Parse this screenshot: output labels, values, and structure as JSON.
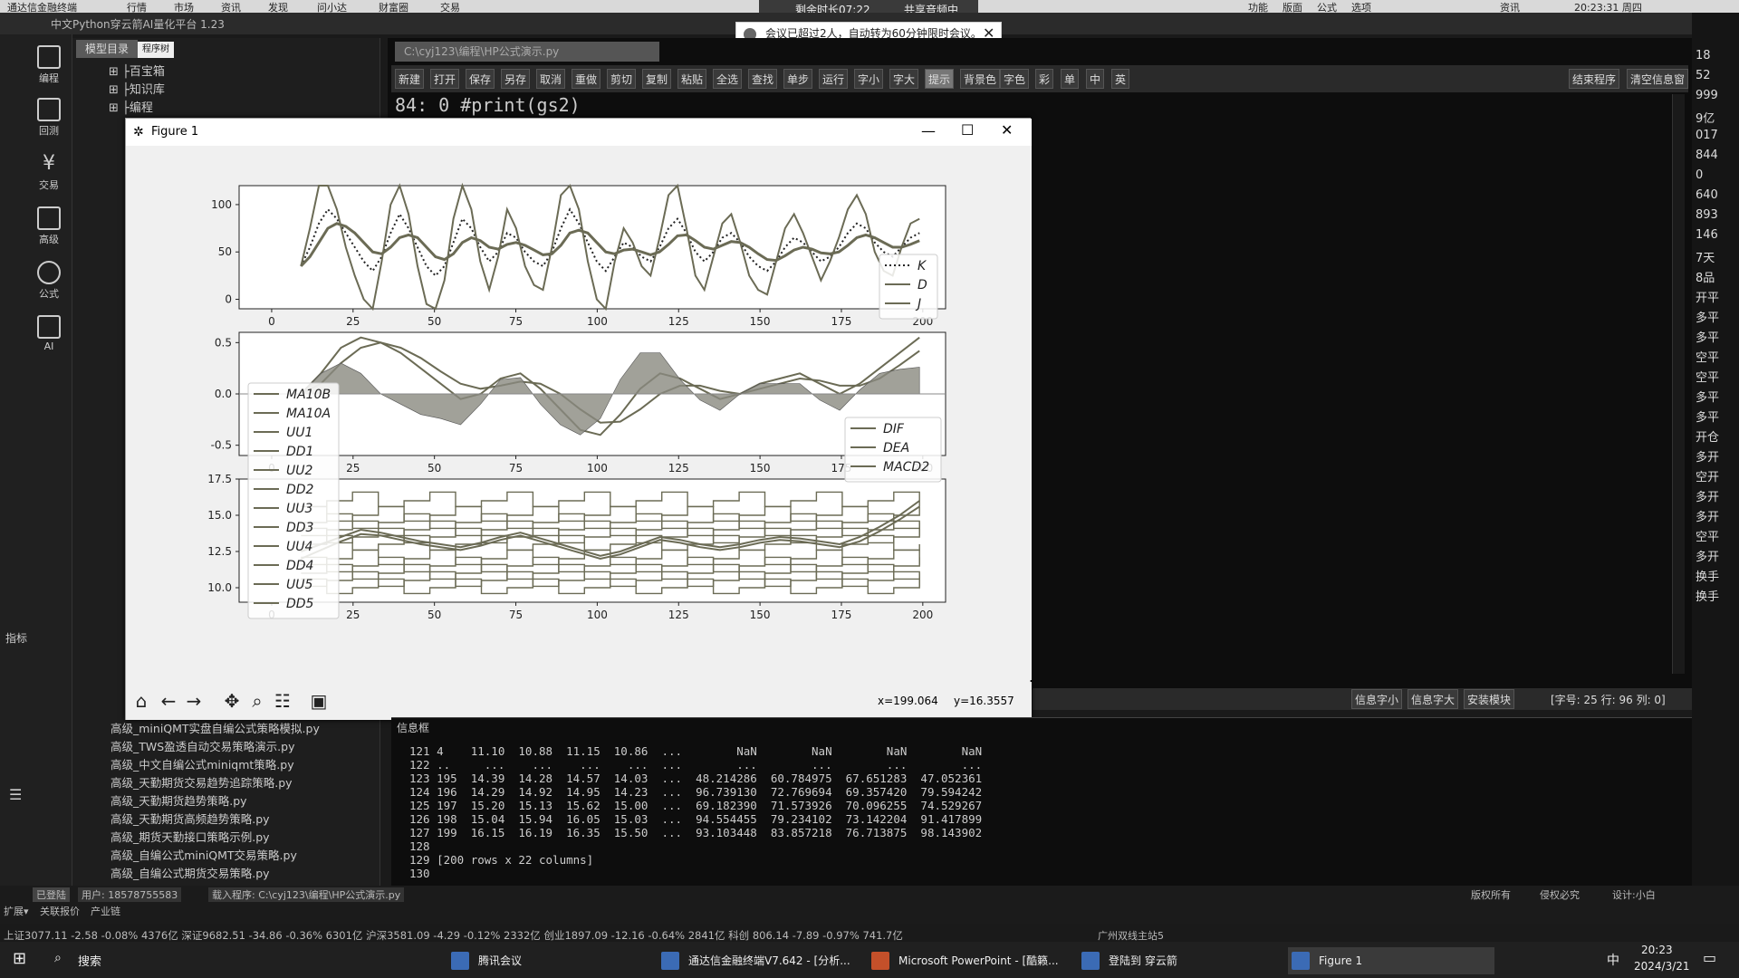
{
  "menubar": {
    "items": [
      "通达信金融终端",
      "行情",
      "市场",
      "资讯",
      "发现",
      "问小达",
      "财富圈",
      "交易",
      "功能",
      "版面",
      "公式",
      "选项",
      "资讯"
    ],
    "clock": "20:23:31 周四"
  },
  "app": {
    "title": "中文Python穿云箭AI量化平台 1.23",
    "notification": "会议已超过2人，自动转为60分钟限时会议。",
    "meeting_timer": "剩余时长07:22",
    "sharing": "共享音频中"
  },
  "leftbar": {
    "items": [
      "编程",
      "回测",
      "交易",
      "高级",
      "公式",
      "AI"
    ],
    "indicator_label": "指标"
  },
  "tree": {
    "tabs": [
      "模型目录",
      "程序树"
    ],
    "top_items": [
      "百宝箱",
      "知识库",
      "编程"
    ],
    "files": [
      "高级_miniQMT实盘自编公式策略模拟.py",
      "高级_TWS盈透自动交易策略演示.py",
      "高级_中文自编公式miniqmt策略.py",
      "高级_天勤期货交易趋势追踪策略.py",
      "高级_天勤期货趋势策略.py",
      "高级_天勤期货高频趋势策略.py",
      "高级_期货天勤接口策略示例.py",
      "高级_自编公式miniQMT交易策略.py",
      "高级_自编公式期货交易策略.py"
    ]
  },
  "editor": {
    "tab": "C:\\cyj123\\编程\\HP公式演示.py",
    "toolbar": [
      "新建",
      "打开",
      "保存",
      "另存",
      "取消",
      "重做",
      "剪切",
      "复制",
      "粘贴",
      "全选",
      "查找",
      "单步",
      "运行",
      "字小",
      "字大",
      "提示",
      "背景色",
      "字色",
      "彩",
      "单",
      "中",
      "英"
    ],
    "toolbar_right": [
      "结束程序",
      "清空信息窗"
    ],
    "code_line": "84: 0 #print(gs2)",
    "status_buttons": [
      "信息字小",
      "信息字大",
      "安装模块"
    ],
    "status_pos": "[字号: 25   行: 96   列: 0]"
  },
  "figure": {
    "title": "Figure 1",
    "coords": "x=199.064",
    "coords_y": "y=16.3557",
    "kdj_legend": [
      "K",
      "D",
      "J"
    ],
    "macd_legend": [
      "DIF",
      "DEA",
      "MACD2"
    ],
    "band_legend": [
      "MA10B",
      "MA10A",
      "UU1",
      "DD1",
      "UU2",
      "DD2",
      "UU3",
      "DD3",
      "UU4",
      "DD4",
      "UU5",
      "DD5"
    ],
    "x_ticks": [
      "0",
      "25",
      "50",
      "75",
      "100",
      "125",
      "150",
      "175",
      "200"
    ],
    "y_ticks_kdj": [
      "100",
      "50",
      "0"
    ],
    "y_ticks_macd": [
      "0.5",
      "0.0",
      "-0.5"
    ],
    "y_ticks_band": [
      "17.5",
      "15.0",
      "12.5",
      "10.0"
    ]
  },
  "output": {
    "title": "信息框",
    "lines": [
      "121 4    11.10  10.88  11.15  10.86  ...        NaN        NaN        NaN        NaN",
      "122 ..     ...    ...    ...    ...  ...        ...        ...        ...        ...",
      "123 195  14.39  14.28  14.57  14.03  ...  48.214286  60.784975  67.651283  47.052361",
      "124 196  14.29  14.92  14.95  14.23  ...  96.739130  72.769694  69.357420  79.594242",
      "125 197  15.20  15.13  15.62  15.00  ...  69.182390  71.573926  70.096255  74.529267",
      "126 198  15.04  15.94  16.05  15.03  ...  94.554455  79.234102  73.142204  91.417899",
      "127 199  16.15  16.19  16.35  15.50  ...  93.103448  83.857218  76.713875  98.143902",
      "128",
      "129 [200 rows x 22 columns]",
      "130"
    ]
  },
  "statusbar": {
    "user": "用户: 18578755583",
    "program": "载入程序: C:\\cyj123\\编程\\HP公式演示.py",
    "login": "已登陆",
    "right_items": [
      "版权所有",
      "侵权必究",
      "设计:小白"
    ],
    "ticker": "上证3077.11  -2.58  -0.08% 4376亿  深证9682.51  -34.86  -0.36% 6301亿  沪深3581.09  -4.29  -0.12% 2332亿  创业1897.09  -12.16  -0.64% 2841亿  科创 806.14  -7.89  -0.97% 741.7亿",
    "station": "广州双线主站5",
    "left_links": [
      "扩展▾",
      "关联报价",
      "产业链"
    ]
  },
  "taskbar": {
    "search": "搜索",
    "apps": [
      "腾讯会议",
      "通达信金融终端V7.642 - [分析...",
      "Microsoft PowerPoint - [酷籁...",
      "登陆到 穿云箭",
      "Figure 1"
    ],
    "time": "20:23",
    "date": "2024/3/21",
    "ime": "中"
  },
  "rightstrip": {
    "labels": [
      "18",
      "52",
      "999",
      "9亿",
      "017",
      "844",
      "0",
      "640",
      "893",
      "146",
      "7天",
      "8品",
      "开平",
      "多平",
      "多平",
      "空平",
      "空平",
      "多平",
      "多平",
      "开仓",
      "多开",
      "空开",
      "多开",
      "多开",
      "空平",
      "多开",
      "换手",
      "换手"
    ]
  },
  "chart_data": [
    {
      "type": "line",
      "title": "",
      "series": [
        {
          "name": "K",
          "style": "dotted",
          "values": [
            35,
            55,
            80,
            95,
            85,
            70,
            55,
            40,
            30,
            45,
            70,
            90,
            75,
            55,
            35,
            25,
            35,
            60,
            85,
            75,
            55,
            40,
            50,
            70,
            65,
            50,
            40,
            35,
            50,
            75,
            95,
            80,
            60,
            40,
            30,
            45,
            60,
            55,
            45,
            40,
            55,
            75,
            85,
            70,
            50,
            40,
            50,
            65,
            70,
            60,
            45,
            35,
            30,
            40,
            55,
            65,
            60,
            50,
            40,
            45,
            55,
            70,
            80,
            75,
            60,
            50,
            45,
            55,
            65,
            70
          ]
        },
        {
          "name": "D",
          "style": "solid",
          "values": [
            35,
            45,
            60,
            75,
            80,
            77,
            70,
            60,
            50,
            48,
            55,
            65,
            68,
            65,
            55,
            45,
            42,
            48,
            60,
            65,
            62,
            55,
            53,
            58,
            60,
            57,
            52,
            47,
            48,
            57,
            70,
            73,
            70,
            60,
            50,
            48,
            52,
            53,
            50,
            47,
            50,
            58,
            67,
            68,
            62,
            55,
            53,
            57,
            61,
            60,
            55,
            48,
            42,
            41,
            46,
            52,
            55,
            53,
            49,
            48,
            50,
            57,
            65,
            68,
            65,
            60,
            55,
            55,
            58,
            62
          ]
        },
        {
          "name": "J",
          "style": "solid",
          "values": [
            35,
            75,
            120,
            130,
            95,
            55,
            25,
            0,
            -10,
            40,
            100,
            140,
            90,
            35,
            -5,
            -15,
            20,
            85,
            135,
            95,
            40,
            10,
            45,
            95,
            75,
            35,
            15,
            10,
            55,
            110,
            145,
            95,
            40,
            0,
            -10,
            40,
            75,
            60,
            35,
            25,
            65,
            110,
            120,
            75,
            25,
            10,
            45,
            80,
            90,
            60,
            25,
            10,
            5,
            40,
            75,
            90,
            70,
            45,
            20,
            40,
            65,
            95,
            110,
            90,
            50,
            30,
            25,
            55,
            80,
            85
          ]
        }
      ],
      "x_range": [
        0,
        200
      ],
      "ylim": [
        -10,
        120
      ]
    },
    {
      "type": "line",
      "series": [
        {
          "name": "DIF",
          "values": [
            0,
            0.2,
            0.45,
            0.55,
            0.5,
            0.4,
            0.25,
            0.1,
            -0.05,
            0.0,
            0.15,
            0.2,
            0.05,
            -0.15,
            -0.35,
            -0.4,
            -0.2,
            0.05,
            0.2,
            0.15,
            0.05,
            -0.05,
            0.0,
            0.1,
            0.15,
            0.2,
            0.1,
            0.0,
            0.1,
            0.25,
            0.4,
            0.55
          ]
        },
        {
          "name": "DEA",
          "values": [
            0,
            0.1,
            0.3,
            0.45,
            0.5,
            0.45,
            0.35,
            0.22,
            0.1,
            0.05,
            0.08,
            0.12,
            0.1,
            0.0,
            -0.15,
            -0.28,
            -0.27,
            -0.15,
            0.0,
            0.08,
            0.08,
            0.03,
            0.0,
            0.05,
            0.1,
            0.15,
            0.13,
            0.08,
            0.08,
            0.15,
            0.28,
            0.42
          ]
        },
        {
          "name": "MACD2",
          "values": [
            0,
            0.2,
            0.3,
            0.2,
            0.0,
            -0.1,
            -0.2,
            -0.24,
            -0.3,
            -0.1,
            0.14,
            0.16,
            -0.1,
            -0.3,
            -0.4,
            -0.24,
            0.14,
            0.4,
            0.4,
            0.14,
            -0.06,
            -0.16,
            0.0,
            0.1,
            0.1,
            0.1,
            -0.06,
            -0.16,
            0.04,
            0.2,
            0.24,
            0.26
          ]
        }
      ],
      "x_range": [
        0,
        200
      ],
      "ylim": [
        -0.6,
        0.6
      ]
    },
    {
      "type": "line",
      "series": [
        {
          "name": "MA10B",
          "values": [
            12.5,
            13.0,
            13.5,
            14.0,
            13.8,
            13.5,
            13.2,
            13.0,
            12.8,
            13.1,
            13.5,
            13.8,
            13.4,
            13.0,
            12.6,
            12.2,
            12.5,
            13.0,
            13.5,
            13.3,
            13.0,
            12.8,
            13.0,
            13.3,
            13.5,
            13.4,
            13.2,
            13.0,
            13.5,
            14.2,
            15.0,
            16.0
          ]
        },
        {
          "name": "MA10A",
          "values": [
            12.0,
            12.6,
            13.2,
            13.7,
            13.6,
            13.3,
            13.0,
            12.8,
            12.6,
            12.9,
            13.3,
            13.6,
            13.2,
            12.8,
            12.4,
            12.0,
            12.3,
            12.8,
            13.3,
            13.1,
            12.8,
            12.6,
            12.8,
            13.1,
            13.3,
            13.2,
            13.0,
            12.8,
            13.2,
            13.9,
            14.7,
            15.6
          ]
        }
      ],
      "levels": [
        10.0,
        10.5,
        11.0,
        11.5,
        12.0,
        13.0,
        13.5,
        14.0,
        14.5,
        15.0,
        16.0
      ],
      "x_range": [
        0,
        200
      ],
      "ylim": [
        9.0,
        17.5
      ]
    }
  ]
}
